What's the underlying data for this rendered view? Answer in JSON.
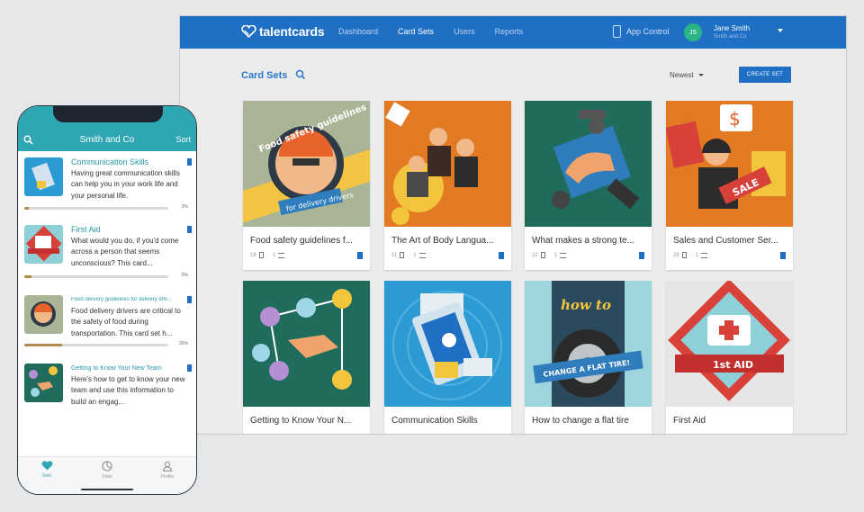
{
  "desktop": {
    "logo_text": "talentcards",
    "nav": [
      "Dashboard",
      "Card Sets",
      "Users",
      "Reports"
    ],
    "nav_active": "Card Sets",
    "app_control": "App Control",
    "user": {
      "initials": "JS",
      "name": "Jane Smith",
      "org": "Smith and Co"
    },
    "page_title": "Card Sets",
    "sort_label": "Newest",
    "create_button": "CREATE SET",
    "cards": [
      {
        "title": "Food safety guidelines f...",
        "count1": "18",
        "count2": "1",
        "art": "food",
        "art_text": [
          "Food safety guidelines",
          "for delivery drivers"
        ]
      },
      {
        "title": "The Art of Body Langua...",
        "count1": "11",
        "count2": "1",
        "art": "body",
        "art_text": []
      },
      {
        "title": "What makes a strong te...",
        "count1": "22",
        "count2": "1",
        "art": "team",
        "art_text": []
      },
      {
        "title": "Sales and Customer Ser...",
        "count1": "26",
        "count2": "1",
        "art": "sales",
        "art_text": [
          "SALE",
          "$"
        ]
      },
      {
        "title": "Getting to Know Your N...",
        "count1": "",
        "count2": "",
        "art": "network",
        "art_text": []
      },
      {
        "title": "Communication Skills",
        "count1": "",
        "count2": "",
        "art": "comm",
        "art_text": []
      },
      {
        "title": "How to change a flat tire",
        "count1": "",
        "count2": "",
        "art": "tire",
        "art_text": [
          "how to",
          "CHANGE A FLAT TIRE!"
        ]
      },
      {
        "title": "First Aid",
        "count1": "",
        "count2": "",
        "art": "aid",
        "art_text": [
          "1st AID"
        ]
      }
    ],
    "colors": {
      "brand": "#1f6fc5",
      "accent_green": "#2ab585"
    }
  },
  "phone": {
    "title": "Smith and Co",
    "sort": "Sort",
    "items": [
      {
        "title": "Communication Skills",
        "desc": "Having great communication skills can help you in your work life and your personal life.",
        "progress": 3,
        "pct": "3%"
      },
      {
        "title": "First Aid",
        "desc": "What would you do, if you'd come across a person that seems unconscious? This card...",
        "progress": 5,
        "pct": "5%"
      },
      {
        "title": "Food delivery guidelines for delivery driv...",
        "desc": "Food delivery drivers are critical to the safety of food during transportation. This card set h...",
        "progress": 26,
        "pct": "26%"
      },
      {
        "title": "Getting to Know Your New Team",
        "desc": "Here's how to get to know your new team and use this information to build an engag...",
        "progress": 0,
        "pct": ""
      }
    ],
    "tabs": [
      "Sets",
      "Stats",
      "Profile"
    ],
    "active_tab": "Sets",
    "colors": {
      "header": "#2ea7b2",
      "progress": "#b38a4b"
    }
  }
}
